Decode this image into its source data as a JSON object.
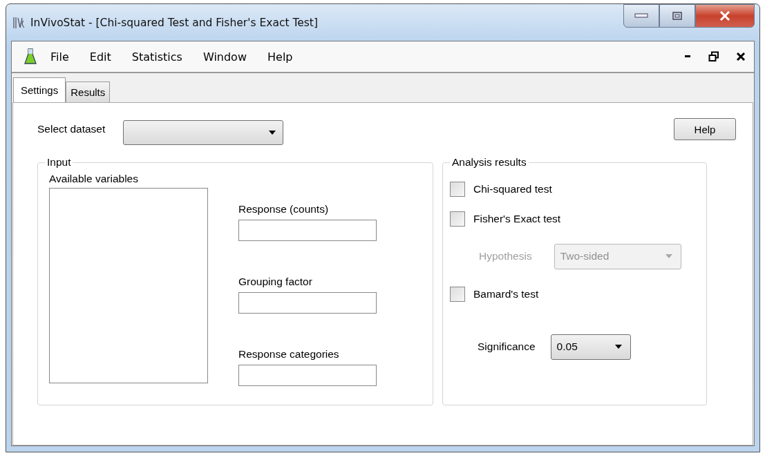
{
  "window": {
    "title": "InVivoStat - [Chi-squared Test and Fisher's Exact Test]"
  },
  "menu": [
    "File",
    "Edit",
    "Statistics",
    "Window",
    "Help"
  ],
  "tabs": [
    {
      "label": "Settings",
      "selected": true
    },
    {
      "label": "Results",
      "selected": false
    }
  ],
  "dataset": {
    "label": "Select dataset"
  },
  "help_button": "Help",
  "input": {
    "title": "Input",
    "available_label": "Available variables",
    "fields": [
      {
        "label": "Response (counts)"
      },
      {
        "label": "Grouping factor"
      },
      {
        "label": "Response categories"
      }
    ]
  },
  "analysis": {
    "title": "Analysis results",
    "items": [
      {
        "kind": "checkbox",
        "label": "Chi-squared test",
        "checked": false
      },
      {
        "kind": "checkbox",
        "label": "Fisher's Exact test",
        "checked": false
      },
      {
        "kind": "dropdown",
        "label": "Hypothesis",
        "value": "Two-sided",
        "disabled": true
      },
      {
        "kind": "checkbox",
        "label": "Bamard's test",
        "checked": false
      },
      {
        "kind": "dropdown",
        "label": "Significance",
        "value": "0.05",
        "disabled": false
      }
    ]
  }
}
